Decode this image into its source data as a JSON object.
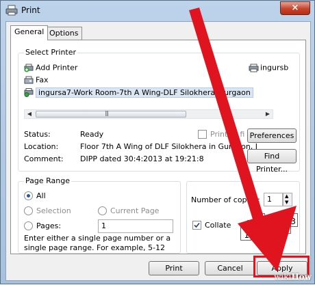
{
  "window": {
    "title": "Print",
    "close_glyph": "×",
    "close_color": "#c4442c"
  },
  "tabs": [
    {
      "label": "General",
      "active": true
    },
    {
      "label": "Options",
      "active": false
    }
  ],
  "select_printer": {
    "group_label": "Select Printer",
    "printers": [
      {
        "name": "Add Printer",
        "icon": "add-printer-icon"
      },
      {
        "name": "Fax",
        "icon": "fax-icon"
      },
      {
        "name": "ingursa7-Work Room-7th A Wing-DLF Silokhera-Gurgaon",
        "icon": "network-printer-icon",
        "selected": true
      },
      {
        "name": "ingursb",
        "icon": "printer-icon"
      }
    ],
    "status_label": "Status:",
    "status_value": "Ready",
    "location_label": "Location:",
    "location_value": "Floor 7th A Wing of DLF Silokhera in Gurgaon, I",
    "comment_label": "Comment:",
    "comment_value": "DIPP dated 30:4:2013 at 19:21:8",
    "print_to_file_label": "Print to fi",
    "preferences_label": "Preferences",
    "find_printer_label": "Find Printer..."
  },
  "page_range": {
    "group_label": "Page Range",
    "all_label": "All",
    "selection_label": "Selection",
    "current_page_label": "Current Page",
    "pages_label": "Pages:",
    "pages_value": "1",
    "selected_option": "All",
    "hint": "Enter either a single page number or a single page range.  For example, 5-12"
  },
  "copies": {
    "number_label": "Number of copies:",
    "number_value": "1",
    "collate_label": "Collate",
    "collate_checked": true,
    "collate_page_numbers": [
      "1",
      "2",
      "3",
      "1",
      "2",
      "3"
    ]
  },
  "buttons": {
    "print": "Print",
    "cancel": "Cancel",
    "apply": "Apply"
  },
  "overlay": {
    "arrow_color": "#e0141e",
    "watermark_prefix": "wiki",
    "watermark_suffix": "How"
  }
}
